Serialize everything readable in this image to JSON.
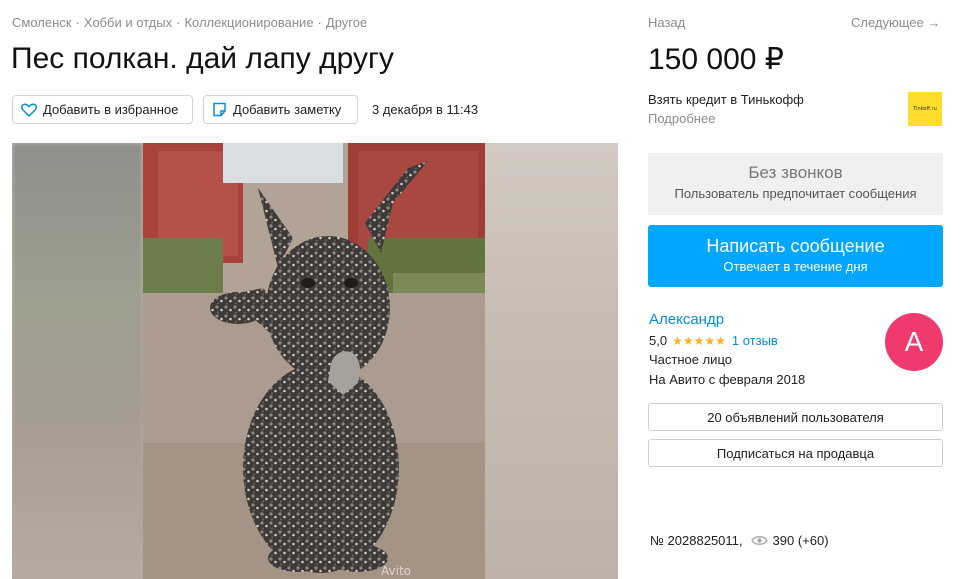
{
  "breadcrumb": {
    "items": [
      "Смоленск",
      "Хобби и отдых",
      "Коллекционирование",
      "Другое"
    ],
    "separator": "·"
  },
  "listing": {
    "title": "Пес полкан. дай лапу другу",
    "price": "150 000 ₽",
    "posted_date": "3 декабря в 11:43",
    "number": "№ 2028825011,",
    "views": "390 (+60)",
    "photo_watermark": "Avito"
  },
  "actions": {
    "favorite_label": "Добавить в избранное",
    "note_label": "Добавить заметку"
  },
  "navigation": {
    "back_label": "Назад",
    "next_label": "Следующее →"
  },
  "credit": {
    "title": "Взять кредит в Тинькофф",
    "more_label": "Подробнее",
    "logo_text": "Tinkoff.ru"
  },
  "contact": {
    "no_calls_title": "Без звонков",
    "no_calls_subtitle": "Пользователь предпочитает сообщения",
    "message_button_label": "Написать сообщение",
    "message_button_sub": "Отвечает в течение дня"
  },
  "seller": {
    "name": "Александр",
    "rating": "5,0",
    "stars": "★★★★★",
    "reviews": "1 отзыв",
    "type": "Частное лицо",
    "since": "На Авито с февраля 2018",
    "avatar_letter": "А",
    "listings_button": "20 объявлений пользователя",
    "subscribe_button": "Подписаться на продавца"
  },
  "colors": {
    "accent_blue": "#00a6ff",
    "link_blue": "#0091d9",
    "avatar_pink": "#f03a6e",
    "star_yellow": "#ffb021",
    "tinkoff_yellow": "#ffdd2d"
  },
  "icons": [
    "heart-icon",
    "note-icon",
    "eye-icon",
    "arrow-right-icon"
  ]
}
